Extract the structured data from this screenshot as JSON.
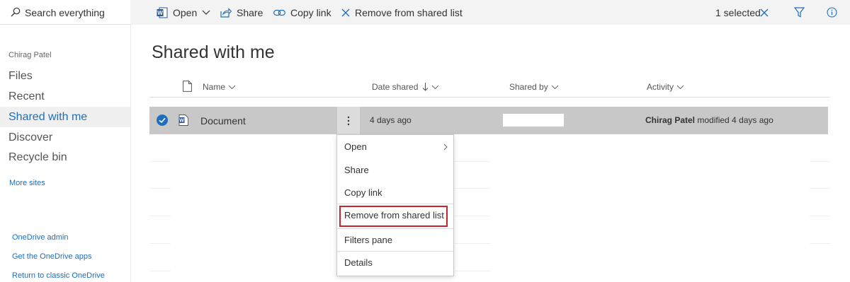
{
  "search": {
    "placeholder": "Search everything"
  },
  "nav": {
    "user_name": "Chirag Patel",
    "items": [
      {
        "label": "Files"
      },
      {
        "label": "Recent"
      },
      {
        "label": "Shared with me"
      },
      {
        "label": "Discover"
      },
      {
        "label": "Recycle bin"
      }
    ],
    "more_sites": "More sites",
    "bottom_links": [
      "OneDrive admin",
      "Get the OneDrive apps",
      "Return to classic OneDrive"
    ]
  },
  "commands": {
    "open": "Open",
    "share": "Share",
    "copy_link": "Copy link",
    "remove": "Remove from shared list",
    "selected": "1 selected"
  },
  "page": {
    "title": "Shared with me",
    "columns": {
      "name": "Name",
      "date_shared": "Date shared",
      "shared_by": "Shared by",
      "activity": "Activity"
    }
  },
  "row": {
    "name": "Document",
    "date_shared": "4 days ago",
    "activity_user": "Chirag Patel",
    "activity_text": " modified 4 days ago"
  },
  "menu": {
    "items": [
      "Open",
      "Share",
      "Copy link",
      "Remove from shared list",
      "Filters pane",
      "Details"
    ]
  },
  "colors": {
    "accent": "#1e6ebb",
    "highlight": "#c4262e",
    "selected_row": "#c8c8c8"
  }
}
